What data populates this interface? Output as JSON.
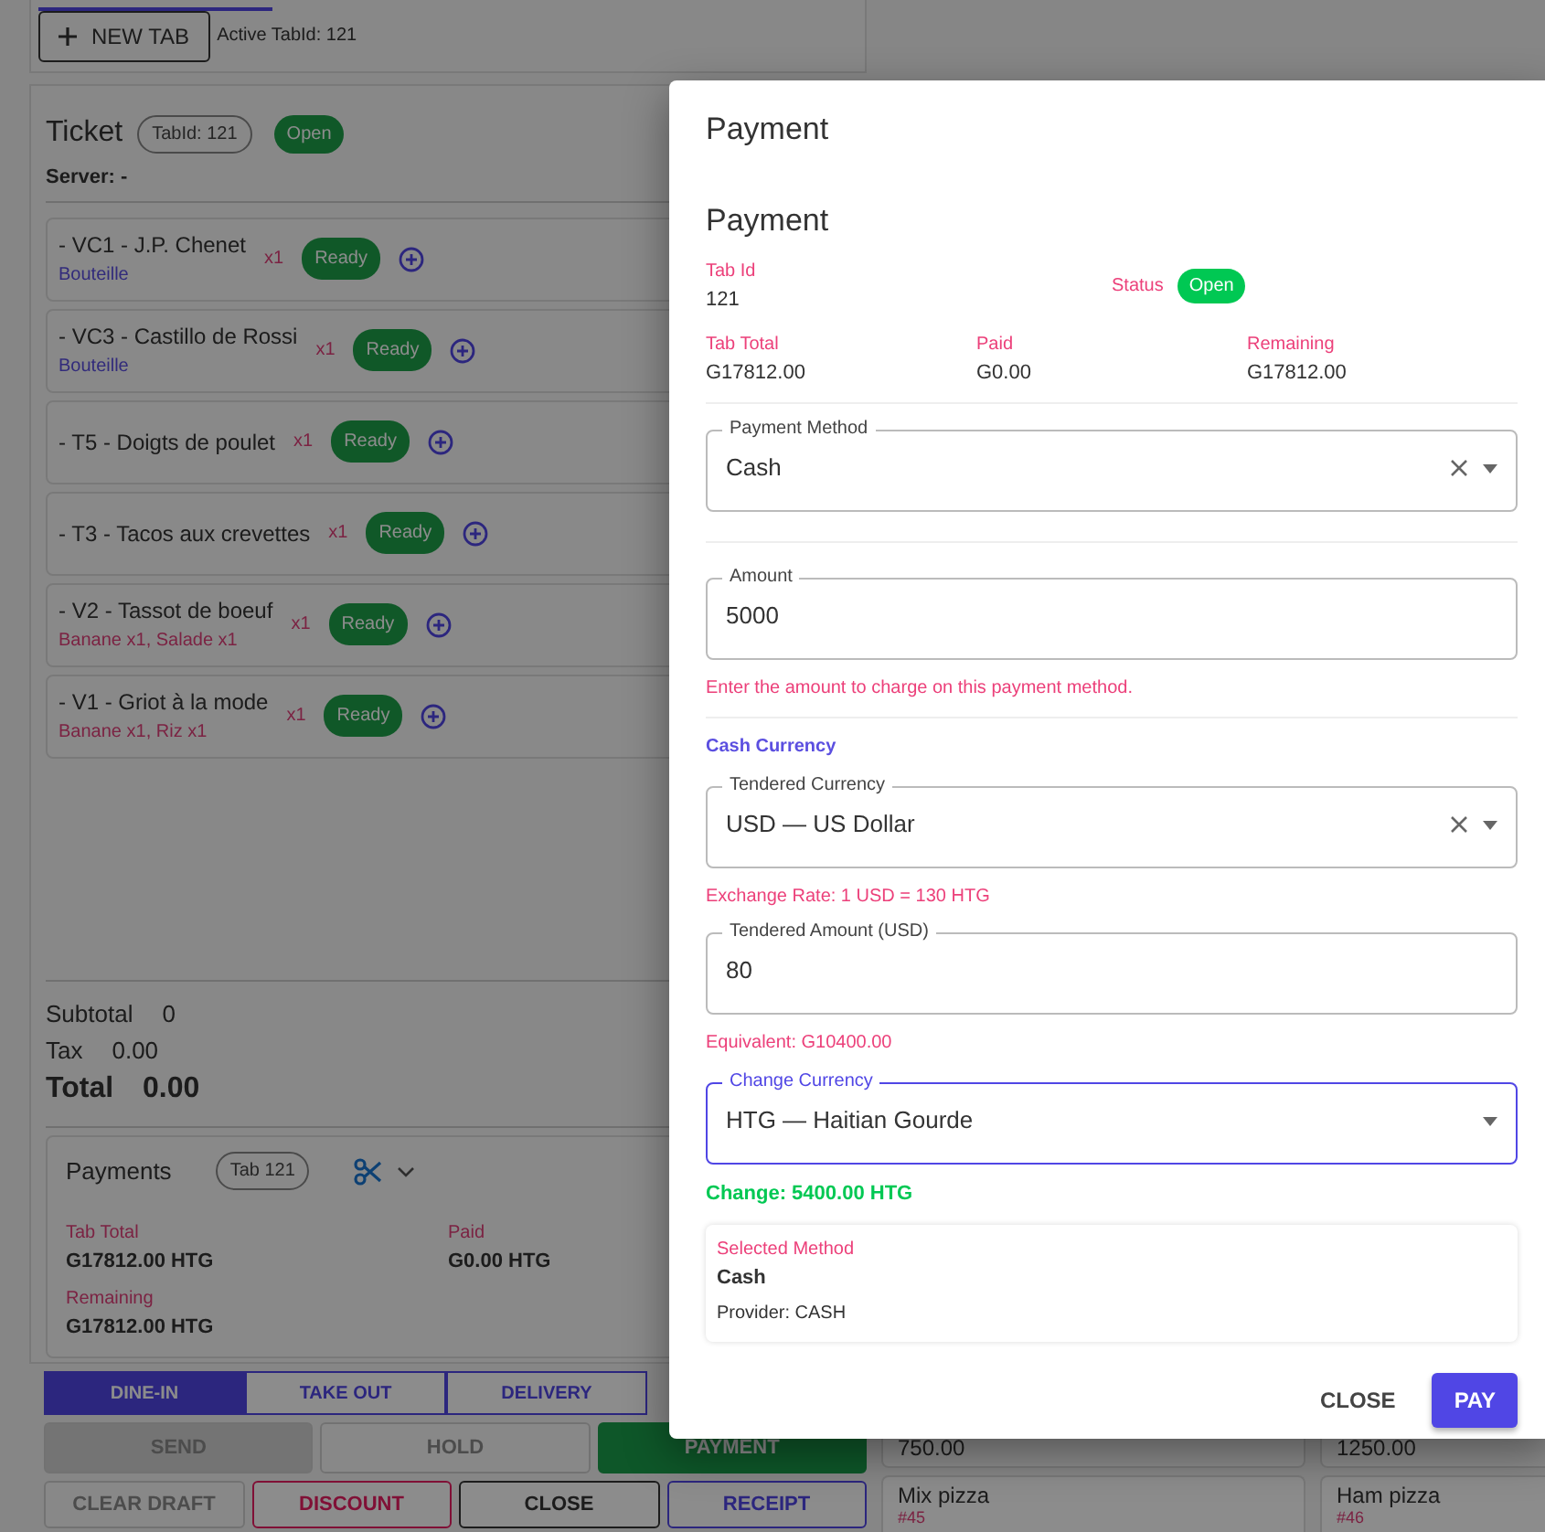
{
  "top_bar": {
    "new_tab_button": "NEW TAB",
    "active_tab": "Active TabId: 121"
  },
  "ticket": {
    "title": "Ticket",
    "tab_badge": "TabId: 121",
    "status": "Open",
    "server": "Server: -",
    "items": [
      {
        "name": "- VC1 - J.P. Chenet",
        "variant": "Bouteille",
        "qty": "x1",
        "status": "Ready"
      },
      {
        "name": "- VC3 - Castillo de Rossi",
        "variant": "Bouteille",
        "qty": "x1",
        "status": "Ready"
      },
      {
        "name": "- T5 - Doigts de poulet",
        "qty": "x1",
        "status": "Ready"
      },
      {
        "name": "- T3 - Tacos aux crevettes",
        "qty": "x1",
        "status": "Ready"
      },
      {
        "name": "- V2 - Tassot de boeuf",
        "modifiers": "Banane x1, Salade x1",
        "qty": "x1",
        "status": "Ready"
      },
      {
        "name": "- V1 - Griot à la mode",
        "modifiers": "Banane x1, Riz x1",
        "qty": "x1",
        "status": "Ready"
      }
    ],
    "subtotal": {
      "label": "Subtotal",
      "value": "0"
    },
    "tax": {
      "label": "Tax",
      "value": "0.00"
    },
    "total": {
      "label": "Total",
      "value": "0.00"
    }
  },
  "payments": {
    "title": "Payments",
    "tab_badge": "Tab 121",
    "summary": [
      {
        "label": "Tab Total",
        "value": "G17812.00 HTG"
      },
      {
        "label": "Paid",
        "value": "G0.00 HTG"
      },
      {
        "label": "Remaining",
        "value": "G17812.00 HTG"
      }
    ]
  },
  "order_types": [
    {
      "label": "DINE-IN",
      "selected": true
    },
    {
      "label": "TAKE OUT",
      "selected": false
    },
    {
      "label": "DELIVERY",
      "selected": false
    }
  ],
  "actions": [
    {
      "label": "SEND",
      "kind": "filled-grey",
      "disabled": true
    },
    {
      "label": "HOLD",
      "kind": "outline",
      "disabled": true
    },
    {
      "label": "PAYMENT",
      "kind": "filled-green",
      "disabled": false
    },
    {
      "label": "CLEAR DRAFT",
      "kind": "outline",
      "disabled": true
    },
    {
      "label": "DISCOUNT",
      "kind": "outline-pink",
      "disabled": false
    },
    {
      "label": "CLOSE",
      "kind": "outline-dark",
      "disabled": false
    },
    {
      "label": "RECEIPT",
      "kind": "outline-purple",
      "disabled": false
    }
  ],
  "products": [
    {
      "price": "750.00"
    },
    {
      "price": "1250.00"
    },
    {
      "name": "Mix pizza",
      "code": "#45"
    },
    {
      "name": "Ham pizza",
      "code": "#46"
    }
  ],
  "dialog": {
    "title": "Payment",
    "heading": "Payment",
    "tab_id": {
      "label": "Tab Id",
      "value": "121"
    },
    "status": {
      "label": "Status",
      "value": "Open"
    },
    "totals": [
      {
        "label": "Tab Total",
        "value": "G17812.00"
      },
      {
        "label": "Paid",
        "value": "G0.00"
      },
      {
        "label": "Remaining",
        "value": "G17812.00"
      }
    ],
    "payment_method": {
      "label": "Payment Method",
      "value": "Cash",
      "clearable": true,
      "focused": false
    },
    "amount": {
      "label": "Amount",
      "value": "5000",
      "helper": "Enter the amount to charge on this payment method."
    },
    "cash_section": "Cash Currency",
    "tendered_currency": {
      "label": "Tendered Currency",
      "value": "USD — US Dollar",
      "clearable": true,
      "focused": false
    },
    "exchange_rate": "Exchange Rate: 1 USD = 130 HTG",
    "tendered_amount": {
      "label": "Tendered Amount (USD)",
      "value": "80"
    },
    "equivalent": "Equivalent: G10400.00",
    "change_currency": {
      "label": "Change Currency",
      "value": "HTG — Haitian Gourde",
      "clearable": false,
      "focused": true
    },
    "change": "Change: 5400.00 HTG",
    "selected_method": {
      "label": "Selected Method",
      "name": "Cash",
      "provider": "Provider: CASH"
    },
    "buttons": [
      {
        "label": "CLOSE",
        "kind": "text"
      },
      {
        "label": "PAY",
        "kind": "primary"
      }
    ]
  }
}
